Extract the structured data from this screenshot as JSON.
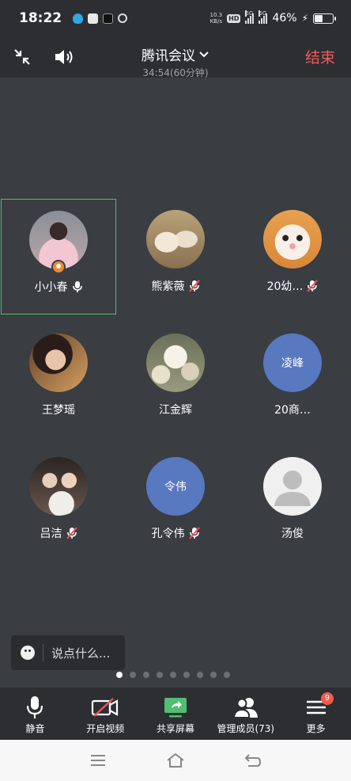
{
  "status_bar": {
    "time": "18:22",
    "net_speed_value": "10.3",
    "net_speed_unit": "KB/s",
    "hd_label": "HD",
    "signal1_label": "5G",
    "signal2_label": "5G",
    "battery_percent": "46%",
    "battery_level": 0.46
  },
  "header": {
    "title": "腾讯会议",
    "subtitle": "34:54(60分钟)",
    "end_label": "结束"
  },
  "participants": [
    {
      "name": "小小春",
      "mic": "on",
      "avatar": "photo-girl",
      "host": true,
      "active": true
    },
    {
      "name": "熊紫薇",
      "mic": "muted",
      "avatar": "photo-rabbits"
    },
    {
      "name": "20幼…",
      "mic": "muted",
      "avatar": "photo-cat"
    },
    {
      "name": "王梦瑶",
      "mic": "none",
      "avatar": "photo-woman"
    },
    {
      "name": "江金辉",
      "mic": "none",
      "avatar": "photo-flowers"
    },
    {
      "name": "20商…",
      "mic": "none",
      "avatar": "initial",
      "initial": "凌峰"
    },
    {
      "name": "吕洁",
      "mic": "muted",
      "avatar": "photo-friends"
    },
    {
      "name": "孔令伟",
      "mic": "muted",
      "avatar": "initial",
      "initial": "令伟"
    },
    {
      "name": "汤俊",
      "mic": "none",
      "avatar": "default"
    }
  ],
  "chat": {
    "placeholder": "说点什么..."
  },
  "pagination": {
    "total": 9,
    "current": 1
  },
  "toolbar": {
    "mute_label": "静音",
    "video_label": "开启视频",
    "share_label": "共享屏幕",
    "members_label": "管理成员(73)",
    "more_label": "更多",
    "more_badge": "9"
  },
  "colors": {
    "accent_green": "#4fbf72",
    "end_red": "#f25a5a",
    "muted_red": "#f0505a",
    "initial_avatar": "#5878c0"
  }
}
